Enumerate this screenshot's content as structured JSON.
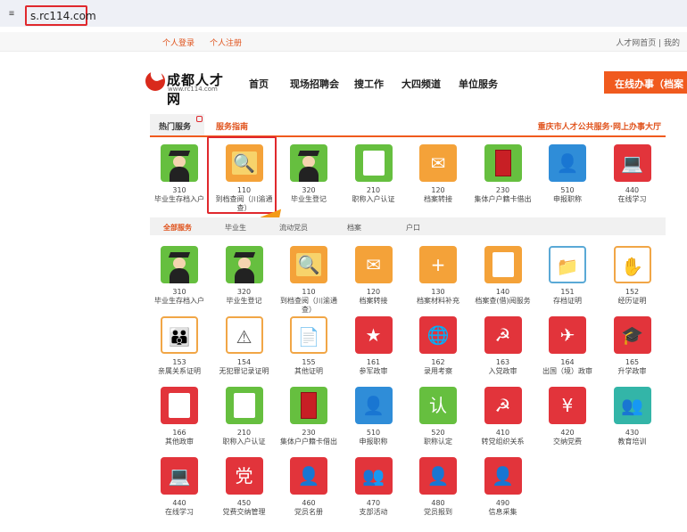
{
  "browser": {
    "url": "s.rc114.com",
    "site_icon": "sliders-icon"
  },
  "topbar": {
    "login": "个人登录",
    "register": "个人注册",
    "right": "人才网首页  |  我的"
  },
  "header": {
    "logo_name": "成都人才网",
    "logo_sub": "www.rc114.com",
    "nav": [
      "首页",
      "现场招聘会",
      "搜工作",
      "大四频道",
      "单位服务"
    ],
    "online_button": "在线办事（档案"
  },
  "section": {
    "hot_tab": "热门服务",
    "guide_tab": "服务指南",
    "right_link": "重庆市人才公共服务·网上办事大厅"
  },
  "hot_services": [
    {
      "code": "310",
      "label": "毕业生存档入户",
      "icon": "graduate-icon"
    },
    {
      "code": "110",
      "label": "到档查阅（川渝通查）",
      "icon": "archive-search-icon"
    },
    {
      "code": "320",
      "label": "毕业生登记",
      "icon": "graduate-icon"
    },
    {
      "code": "210",
      "label": "职称入户认证",
      "icon": "house-certificate-icon"
    },
    {
      "code": "120",
      "label": "档案转接",
      "icon": "envelope-icon"
    },
    {
      "code": "230",
      "label": "集体户户籍卡借出",
      "icon": "red-book-icon"
    },
    {
      "code": "510",
      "label": "申报职称",
      "icon": "person-icon"
    },
    {
      "code": "440",
      "label": "在线学习",
      "icon": "computer-user-icon"
    }
  ],
  "sub_tabs": [
    "全部服务",
    "毕业生",
    "流动党员",
    "档案",
    "户口"
  ],
  "all_services": [
    {
      "code": "310",
      "label": "毕业生存档入户",
      "icon": "graduate-icon"
    },
    {
      "code": "320",
      "label": "毕业生登记",
      "icon": "graduate-icon"
    },
    {
      "code": "110",
      "label": "到档查阅（川渝通查）",
      "icon": "archive-search-icon"
    },
    {
      "code": "120",
      "label": "档案转接",
      "icon": "envelope-icon"
    },
    {
      "code": "130",
      "label": "档案材料补充",
      "icon": "document-add-icon"
    },
    {
      "code": "140",
      "label": "档案查(借)阅服务",
      "icon": "pen-document-icon"
    },
    {
      "code": "151",
      "label": "存档证明",
      "icon": "archive-certificate-icon"
    },
    {
      "code": "152",
      "label": "经历证明",
      "icon": "hand-certificate-icon"
    },
    {
      "code": "153",
      "label": "亲属关系证明",
      "icon": "family-icon"
    },
    {
      "code": "154",
      "label": "无犯罪记录证明",
      "icon": "warning-document-icon"
    },
    {
      "code": "155",
      "label": "其他证明",
      "icon": "document-icon"
    },
    {
      "code": "161",
      "label": "参军政审",
      "icon": "soldier-icon"
    },
    {
      "code": "162",
      "label": "录用考察",
      "icon": "globe-document-icon"
    },
    {
      "code": "163",
      "label": "入党政审",
      "icon": "party-emblem-icon"
    },
    {
      "code": "164",
      "label": "出国（境）政审",
      "icon": "airplane-icon"
    },
    {
      "code": "165",
      "label": "升学政审",
      "icon": "graduation-cap-icon"
    },
    {
      "code": "166",
      "label": "其他政审",
      "icon": "review-icon"
    },
    {
      "code": "210",
      "label": "职称入户认证",
      "icon": "house-certificate-icon"
    },
    {
      "code": "230",
      "label": "集体户户籍卡借出",
      "icon": "red-book-icon"
    },
    {
      "code": "510",
      "label": "申报职称",
      "icon": "person-icon"
    },
    {
      "code": "520",
      "label": "职称认定",
      "icon": "certification-badge-icon"
    },
    {
      "code": "410",
      "label": "转党组织关系",
      "icon": "party-transfer-icon"
    },
    {
      "code": "420",
      "label": "交纳党费",
      "icon": "yuan-house-icon"
    },
    {
      "code": "430",
      "label": "教育培训",
      "icon": "group-training-icon"
    },
    {
      "code": "440",
      "label": "在线学习",
      "icon": "computer-user-icon"
    },
    {
      "code": "450",
      "label": "党费交纳管理",
      "icon": "party-fee-icon"
    },
    {
      "code": "460",
      "label": "党员名册",
      "icon": "member-list-icon"
    },
    {
      "code": "470",
      "label": "支部活动",
      "icon": "branch-activity-icon"
    },
    {
      "code": "480",
      "label": "党员报到",
      "icon": "member-report-icon"
    },
    {
      "code": "490",
      "label": "信息采集",
      "icon": "info-collect-icon"
    }
  ]
}
